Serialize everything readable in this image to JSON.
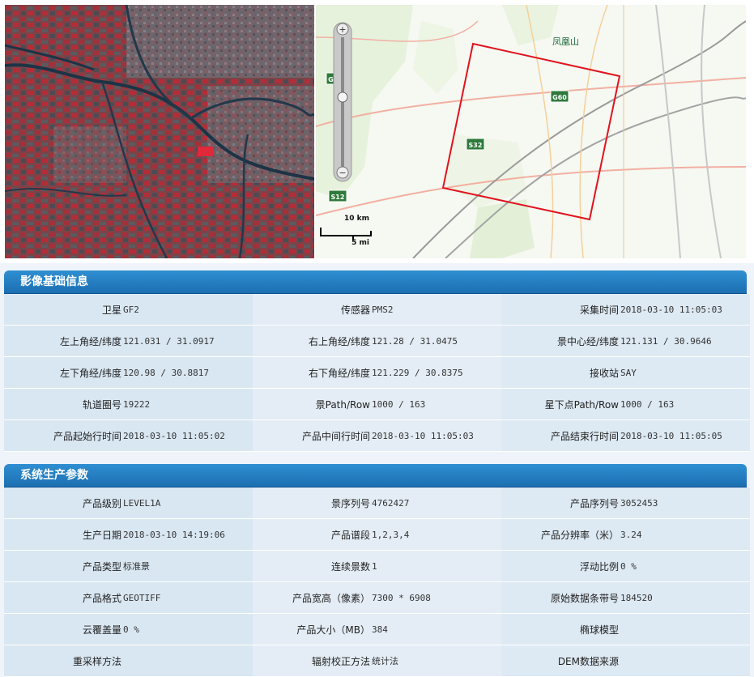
{
  "map": {
    "scale_km": "10 km",
    "scale_mi": "5 mi",
    "place_label": "凤凰山",
    "shields": [
      "G60",
      "S32",
      "S12",
      "G60"
    ],
    "footprint_color": "#e0141e"
  },
  "panel_basic": {
    "title": "影像基础信息",
    "rows": [
      [
        {
          "label": "卫星",
          "value": "GF2"
        },
        {
          "label": "传感器",
          "value": "PMS2"
        },
        {
          "label": "采集时间",
          "value": "2018-03-10 11:05:03"
        }
      ],
      [
        {
          "label": "左上角经/纬度",
          "value": "121.031 / 31.0917"
        },
        {
          "label": "右上角经/纬度",
          "value": "121.28 / 31.0475"
        },
        {
          "label": "景中心经/纬度",
          "value": "121.131 / 30.9646"
        }
      ],
      [
        {
          "label": "左下角经/纬度",
          "value": "120.98 / 30.8817"
        },
        {
          "label": "右下角经/纬度",
          "value": "121.229 / 30.8375"
        },
        {
          "label": "接收站",
          "value": "SAY"
        }
      ],
      [
        {
          "label": "轨道圈号",
          "value": "19222"
        },
        {
          "label": "景Path/Row",
          "value": "1000 / 163"
        },
        {
          "label": "星下点Path/Row",
          "value": "1000 / 163"
        }
      ],
      [
        {
          "label": "产品起始行时间",
          "value": "2018-03-10 11:05:02"
        },
        {
          "label": "产品中间行时间",
          "value": "2018-03-10 11:05:03"
        },
        {
          "label": "产品结束行时间",
          "value": "2018-03-10 11:05:05"
        }
      ]
    ]
  },
  "panel_production": {
    "title": "系统生产参数",
    "rows": [
      [
        {
          "label": "产品级别",
          "value": "LEVEL1A"
        },
        {
          "label": "景序列号",
          "value": "4762427"
        },
        {
          "label": "产品序列号",
          "value": "3052453"
        }
      ],
      [
        {
          "label": "生产日期",
          "value": "2018-03-10 14:19:06"
        },
        {
          "label": "产品谱段",
          "value": "1,2,3,4"
        },
        {
          "label": "产品分辨率（米）",
          "value": "3.24"
        }
      ],
      [
        {
          "label": "产品类型",
          "value": "标准景"
        },
        {
          "label": "连续景数",
          "value": "1"
        },
        {
          "label": "浮动比例",
          "value": "0 %"
        }
      ],
      [
        {
          "label": "产品格式",
          "value": "GEOTIFF"
        },
        {
          "label": "产品宽高（像素）",
          "value": "7300 * 6908"
        },
        {
          "label": "原始数据条带号",
          "value": "184520"
        }
      ],
      [
        {
          "label": "云覆盖量",
          "value": "0 %"
        },
        {
          "label": "产品大小（MB）",
          "value": "384"
        },
        {
          "label": "椭球模型",
          "value": ""
        }
      ],
      [
        {
          "label": "重采样方法",
          "value": ""
        },
        {
          "label": "辐射校正方法",
          "value": "统计法"
        },
        {
          "label": "DEM数据来源",
          "value": ""
        }
      ]
    ]
  }
}
